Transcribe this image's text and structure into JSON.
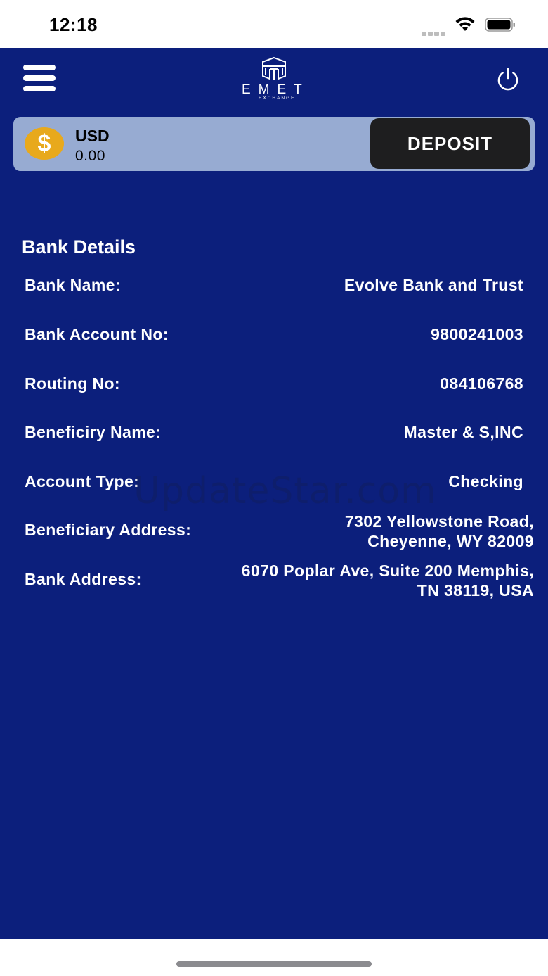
{
  "status_bar": {
    "time": "12:18"
  },
  "header": {
    "logo_text": "EMET",
    "logo_subtext": "EXCHANGE",
    "menu_icon": "hamburger-menu-icon",
    "power_icon": "power-icon"
  },
  "balance": {
    "currency_symbol": "$",
    "currency": "USD",
    "amount": "0.00",
    "deposit_label": "DEPOSIT"
  },
  "bank_details": {
    "title": "Bank Details",
    "rows": [
      {
        "label": "Bank Name:",
        "value": "Evolve Bank and Trust"
      },
      {
        "label": "Bank Account No:",
        "value": "9800241003"
      },
      {
        "label": "Routing No:",
        "value": "084106768"
      },
      {
        "label": "Beneficiry Name:",
        "value": "Master & S,INC"
      },
      {
        "label": "Account Type:",
        "value": "Checking"
      },
      {
        "label": "Beneficiary Address:",
        "value_line1": "7302 Yellowstone Road,",
        "value_line2": "Cheyenne, WY 82009"
      },
      {
        "label": "Bank Address:",
        "value_line1": "6070 Poplar Ave, Suite 200 Memphis,",
        "value_line2": "TN 38119, USA"
      }
    ]
  },
  "watermark": "UpdateStar.com",
  "colors": {
    "background": "#0c1f7c",
    "card": "#97abd2",
    "deposit_button": "#1e1e1f",
    "coin": "#e8a91c"
  }
}
